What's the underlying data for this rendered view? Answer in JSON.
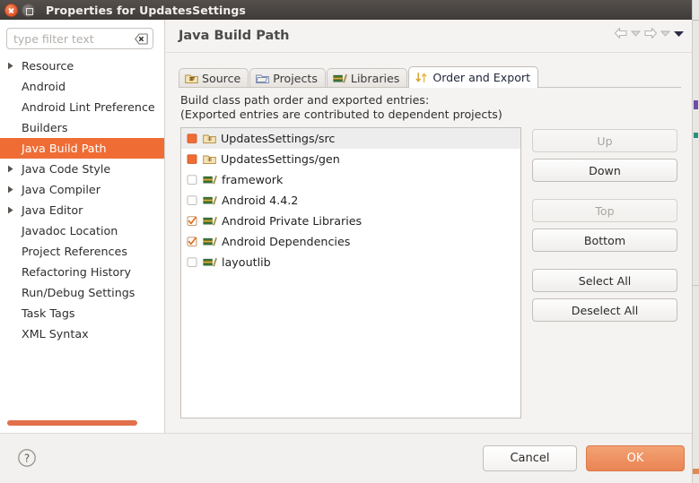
{
  "window": {
    "title": "Properties for UpdatesSettings",
    "close_icon": "close-icon",
    "maximize_icon": "maximize-icon"
  },
  "sidebar": {
    "filter": {
      "placeholder": "type filter text",
      "value": "",
      "clear_icon": "clear-icon"
    },
    "items": [
      {
        "label": "Resource",
        "expandable": true,
        "selected": false
      },
      {
        "label": "Android",
        "expandable": false,
        "selected": false
      },
      {
        "label": "Android Lint Preference",
        "expandable": false,
        "selected": false
      },
      {
        "label": "Builders",
        "expandable": false,
        "selected": false
      },
      {
        "label": "Java Build Path",
        "expandable": false,
        "selected": true
      },
      {
        "label": "Java Code Style",
        "expandable": true,
        "selected": false
      },
      {
        "label": "Java Compiler",
        "expandable": true,
        "selected": false
      },
      {
        "label": "Java Editor",
        "expandable": true,
        "selected": false
      },
      {
        "label": "Javadoc Location",
        "expandable": false,
        "selected": false
      },
      {
        "label": "Project References",
        "expandable": false,
        "selected": false
      },
      {
        "label": "Refactoring History",
        "expandable": false,
        "selected": false
      },
      {
        "label": "Run/Debug Settings",
        "expandable": false,
        "selected": false
      },
      {
        "label": "Task Tags",
        "expandable": false,
        "selected": false
      },
      {
        "label": "XML Syntax",
        "expandable": false,
        "selected": false
      }
    ]
  },
  "header": {
    "title": "Java Build Path",
    "nav": {
      "back_icon": "back-arrow-icon",
      "back_menu_icon": "chevron-down-icon",
      "forward_icon": "forward-arrow-icon",
      "forward_menu_icon": "chevron-down-icon",
      "menu_icon": "chevron-down-icon"
    }
  },
  "tabs": [
    {
      "label": "Source",
      "icon": "source-folder-icon",
      "active": false
    },
    {
      "label": "Projects",
      "icon": "projects-folder-icon",
      "active": false
    },
    {
      "label": "Libraries",
      "icon": "libraries-icon",
      "active": false
    },
    {
      "label": "Order and Export",
      "icon": "order-export-icon",
      "active": true
    }
  ],
  "main": {
    "description_line1": "Build class path order and exported entries:",
    "description_line2": "(Exported entries are contributed to dependent projects)",
    "entries": [
      {
        "label": "UpdatesSettings/src",
        "check": "filled",
        "icon": "source-folder-icon",
        "selected": true
      },
      {
        "label": "UpdatesSettings/gen",
        "check": "filled",
        "icon": "source-folder-icon",
        "selected": false
      },
      {
        "label": "framework",
        "check": "unchecked",
        "icon": "library-icon",
        "selected": false
      },
      {
        "label": "Android 4.4.2",
        "check": "unchecked",
        "icon": "library-icon",
        "selected": false
      },
      {
        "label": "Android Private Libraries",
        "check": "checked",
        "icon": "library-icon",
        "selected": false
      },
      {
        "label": "Android Dependencies",
        "check": "checked",
        "icon": "library-icon",
        "selected": false
      },
      {
        "label": "layoutlib",
        "check": "unchecked",
        "icon": "library-icon",
        "selected": false
      }
    ],
    "buttons": [
      {
        "label": "Up",
        "enabled": false,
        "gap": false
      },
      {
        "label": "Down",
        "enabled": true,
        "gap": false
      },
      {
        "label": "Top",
        "enabled": false,
        "gap": true
      },
      {
        "label": "Bottom",
        "enabled": true,
        "gap": false
      },
      {
        "label": "Select All",
        "enabled": true,
        "gap": true
      },
      {
        "label": "Deselect All",
        "enabled": true,
        "gap": false
      }
    ]
  },
  "footer": {
    "help_icon": "help-icon",
    "cancel_label": "Cancel",
    "ok_label": "OK"
  },
  "colors": {
    "accent_orange": "#ef6d35",
    "ok_button": "#ea8453",
    "titlebar": "#45413e",
    "selection_row": "#ededed"
  }
}
